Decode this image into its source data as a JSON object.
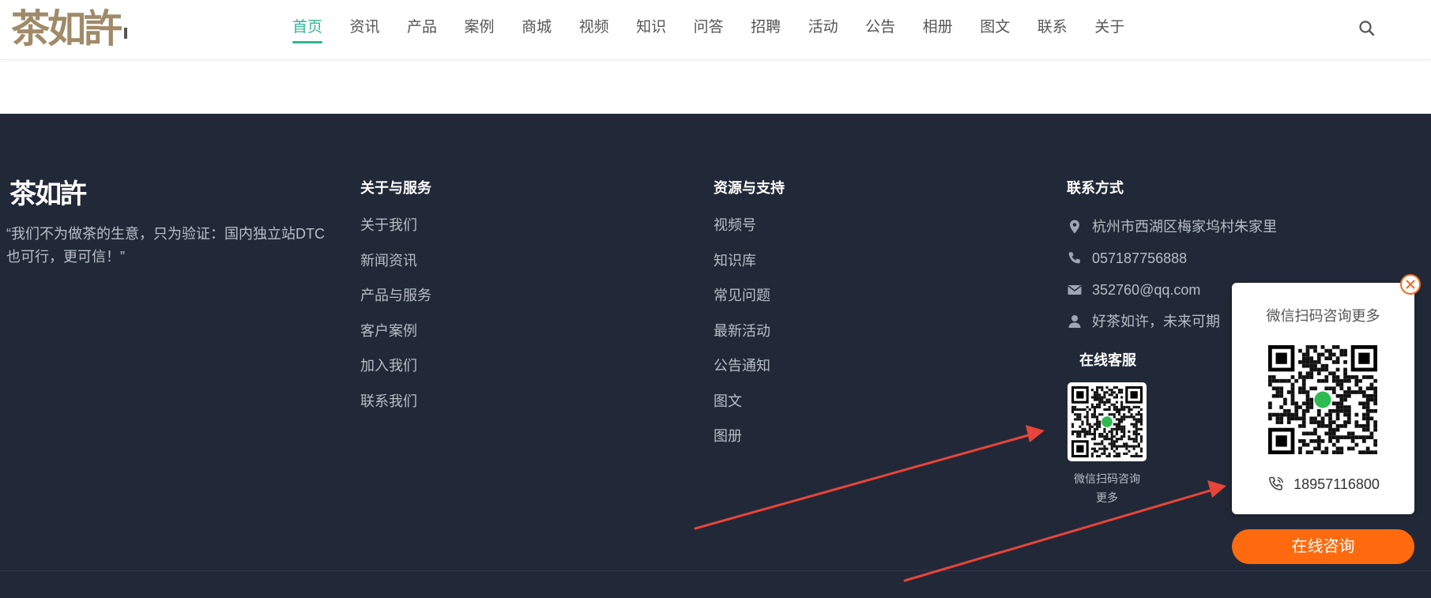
{
  "header": {
    "logo_text": "茶如許",
    "nav": [
      {
        "label": "首页",
        "active": true
      },
      {
        "label": "资讯"
      },
      {
        "label": "产品"
      },
      {
        "label": "案例"
      },
      {
        "label": "商城"
      },
      {
        "label": "视频"
      },
      {
        "label": "知识"
      },
      {
        "label": "问答"
      },
      {
        "label": "招聘"
      },
      {
        "label": "活动"
      },
      {
        "label": "公告"
      },
      {
        "label": "相册"
      },
      {
        "label": "图文"
      },
      {
        "label": "联系"
      },
      {
        "label": "关于"
      }
    ],
    "search_icon": "search-icon"
  },
  "footer": {
    "logo_text": "茶如許",
    "slogan": "“我们不为做茶的生意，只为验证：国内独立站DTC也可行，更可信！”",
    "about": {
      "title": "关于与服务",
      "items": [
        "关于我们",
        "新闻资讯",
        "产品与服务",
        "客户案例",
        "加入我们",
        "联系我们"
      ]
    },
    "resources": {
      "title": "资源与支持",
      "items": [
        "视频号",
        "知识库",
        "常见问题",
        "最新活动",
        "公告通知",
        "图文",
        "图册"
      ]
    },
    "contact": {
      "title": "联系方式",
      "address": "杭州市西湖区梅家坞村朱家里",
      "phone": "057187756888",
      "email": "352760@qq.com",
      "slogan": "好茶如许，未来可期"
    },
    "service": {
      "title": "在线客服",
      "qr_caption_line1": "微信扫码咨询",
      "qr_caption_line2": "更多"
    }
  },
  "popup": {
    "title": "微信扫码咨询更多",
    "phone": "18957116800",
    "button": "在线咨询"
  },
  "colors": {
    "accent": "#2fb592",
    "footer_bg": "#212938",
    "orange": "#ff6a0e",
    "arrow": "#e8443a"
  }
}
